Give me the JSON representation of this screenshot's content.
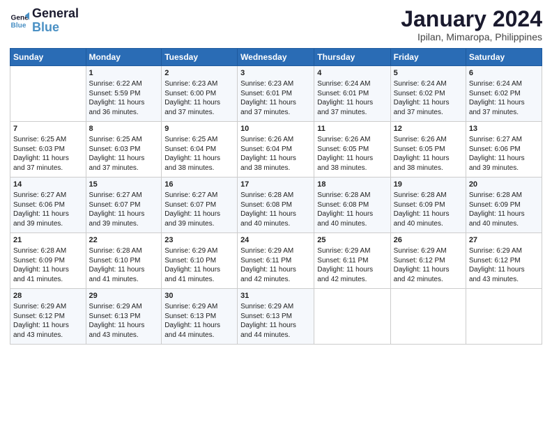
{
  "header": {
    "logo_line1": "General",
    "logo_line2": "Blue",
    "title": "January 2024",
    "subtitle": "Ipilan, Mimaropa, Philippines"
  },
  "columns": [
    "Sunday",
    "Monday",
    "Tuesday",
    "Wednesday",
    "Thursday",
    "Friday",
    "Saturday"
  ],
  "weeks": [
    [
      {
        "day": "",
        "info": ""
      },
      {
        "day": "1",
        "info": "Sunrise: 6:22 AM\nSunset: 5:59 PM\nDaylight: 11 hours\nand 36 minutes."
      },
      {
        "day": "2",
        "info": "Sunrise: 6:23 AM\nSunset: 6:00 PM\nDaylight: 11 hours\nand 37 minutes."
      },
      {
        "day": "3",
        "info": "Sunrise: 6:23 AM\nSunset: 6:01 PM\nDaylight: 11 hours\nand 37 minutes."
      },
      {
        "day": "4",
        "info": "Sunrise: 6:24 AM\nSunset: 6:01 PM\nDaylight: 11 hours\nand 37 minutes."
      },
      {
        "day": "5",
        "info": "Sunrise: 6:24 AM\nSunset: 6:02 PM\nDaylight: 11 hours\nand 37 minutes."
      },
      {
        "day": "6",
        "info": "Sunrise: 6:24 AM\nSunset: 6:02 PM\nDaylight: 11 hours\nand 37 minutes."
      }
    ],
    [
      {
        "day": "7",
        "info": "Sunrise: 6:25 AM\nSunset: 6:03 PM\nDaylight: 11 hours\nand 37 minutes."
      },
      {
        "day": "8",
        "info": "Sunrise: 6:25 AM\nSunset: 6:03 PM\nDaylight: 11 hours\nand 37 minutes."
      },
      {
        "day": "9",
        "info": "Sunrise: 6:25 AM\nSunset: 6:04 PM\nDaylight: 11 hours\nand 38 minutes."
      },
      {
        "day": "10",
        "info": "Sunrise: 6:26 AM\nSunset: 6:04 PM\nDaylight: 11 hours\nand 38 minutes."
      },
      {
        "day": "11",
        "info": "Sunrise: 6:26 AM\nSunset: 6:05 PM\nDaylight: 11 hours\nand 38 minutes."
      },
      {
        "day": "12",
        "info": "Sunrise: 6:26 AM\nSunset: 6:05 PM\nDaylight: 11 hours\nand 38 minutes."
      },
      {
        "day": "13",
        "info": "Sunrise: 6:27 AM\nSunset: 6:06 PM\nDaylight: 11 hours\nand 39 minutes."
      }
    ],
    [
      {
        "day": "14",
        "info": "Sunrise: 6:27 AM\nSunset: 6:06 PM\nDaylight: 11 hours\nand 39 minutes."
      },
      {
        "day": "15",
        "info": "Sunrise: 6:27 AM\nSunset: 6:07 PM\nDaylight: 11 hours\nand 39 minutes."
      },
      {
        "day": "16",
        "info": "Sunrise: 6:27 AM\nSunset: 6:07 PM\nDaylight: 11 hours\nand 39 minutes."
      },
      {
        "day": "17",
        "info": "Sunrise: 6:28 AM\nSunset: 6:08 PM\nDaylight: 11 hours\nand 40 minutes."
      },
      {
        "day": "18",
        "info": "Sunrise: 6:28 AM\nSunset: 6:08 PM\nDaylight: 11 hours\nand 40 minutes."
      },
      {
        "day": "19",
        "info": "Sunrise: 6:28 AM\nSunset: 6:09 PM\nDaylight: 11 hours\nand 40 minutes."
      },
      {
        "day": "20",
        "info": "Sunrise: 6:28 AM\nSunset: 6:09 PM\nDaylight: 11 hours\nand 40 minutes."
      }
    ],
    [
      {
        "day": "21",
        "info": "Sunrise: 6:28 AM\nSunset: 6:09 PM\nDaylight: 11 hours\nand 41 minutes."
      },
      {
        "day": "22",
        "info": "Sunrise: 6:28 AM\nSunset: 6:10 PM\nDaylight: 11 hours\nand 41 minutes."
      },
      {
        "day": "23",
        "info": "Sunrise: 6:29 AM\nSunset: 6:10 PM\nDaylight: 11 hours\nand 41 minutes."
      },
      {
        "day": "24",
        "info": "Sunrise: 6:29 AM\nSunset: 6:11 PM\nDaylight: 11 hours\nand 42 minutes."
      },
      {
        "day": "25",
        "info": "Sunrise: 6:29 AM\nSunset: 6:11 PM\nDaylight: 11 hours\nand 42 minutes."
      },
      {
        "day": "26",
        "info": "Sunrise: 6:29 AM\nSunset: 6:12 PM\nDaylight: 11 hours\nand 42 minutes."
      },
      {
        "day": "27",
        "info": "Sunrise: 6:29 AM\nSunset: 6:12 PM\nDaylight: 11 hours\nand 43 minutes."
      }
    ],
    [
      {
        "day": "28",
        "info": "Sunrise: 6:29 AM\nSunset: 6:12 PM\nDaylight: 11 hours\nand 43 minutes."
      },
      {
        "day": "29",
        "info": "Sunrise: 6:29 AM\nSunset: 6:13 PM\nDaylight: 11 hours\nand 43 minutes."
      },
      {
        "day": "30",
        "info": "Sunrise: 6:29 AM\nSunset: 6:13 PM\nDaylight: 11 hours\nand 44 minutes."
      },
      {
        "day": "31",
        "info": "Sunrise: 6:29 AM\nSunset: 6:13 PM\nDaylight: 11 hours\nand 44 minutes."
      },
      {
        "day": "",
        "info": ""
      },
      {
        "day": "",
        "info": ""
      },
      {
        "day": "",
        "info": ""
      }
    ]
  ]
}
